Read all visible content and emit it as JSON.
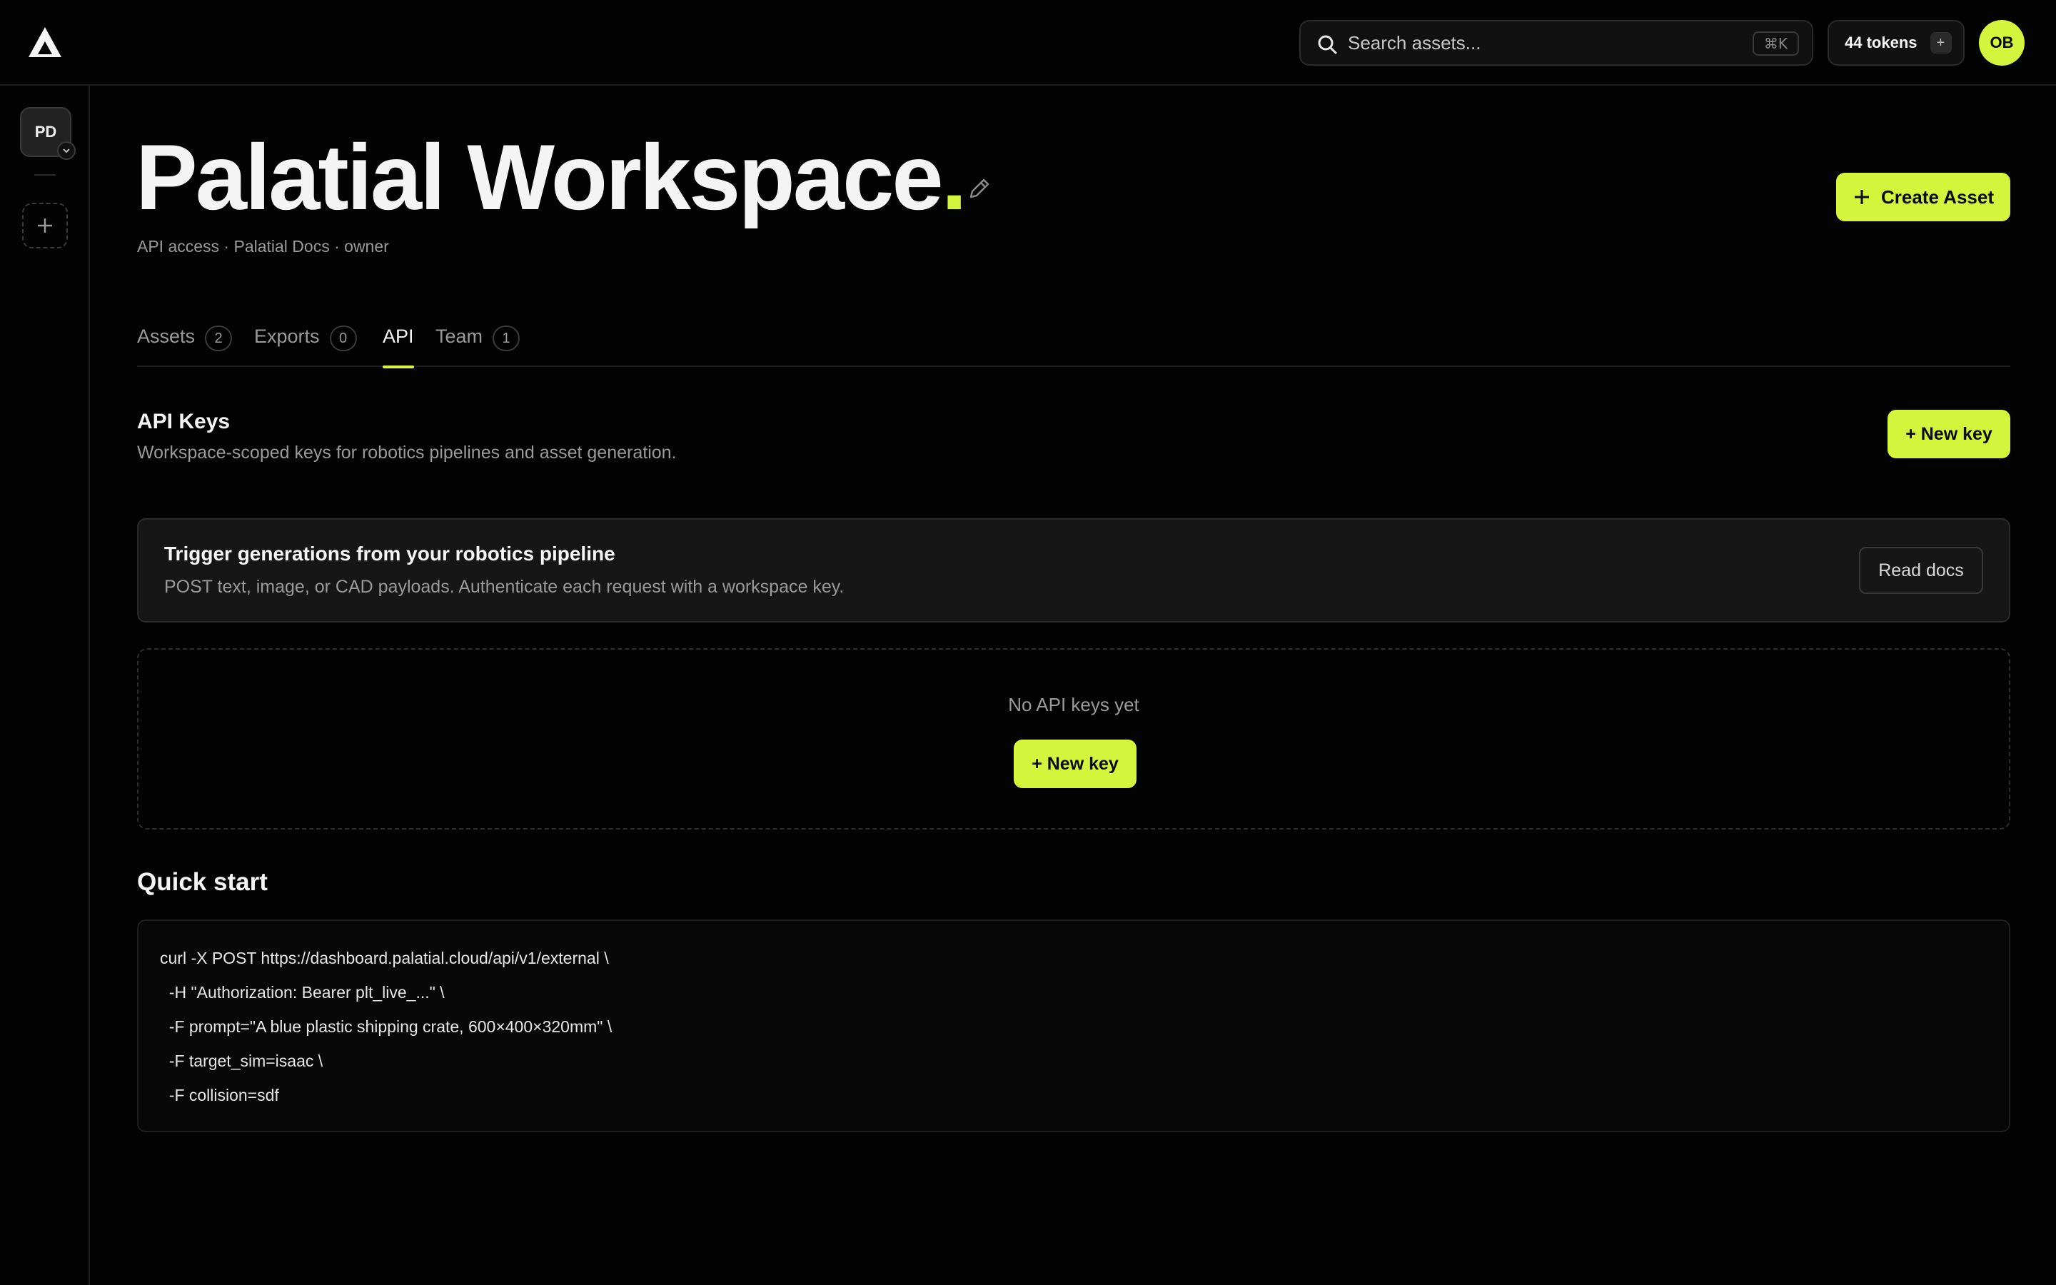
{
  "brand": {
    "accent": "#d4f53c"
  },
  "header": {
    "search_placeholder": "Search assets...",
    "search_shortcut": "⌘K",
    "tokens_label": "44 tokens",
    "tokens_add": "+",
    "user_initials": "OB"
  },
  "sidebar": {
    "workspace_initials": "PD"
  },
  "page": {
    "title": "Palatial Workspace",
    "title_dot": ".",
    "subtitle": "API access · Palatial Docs · owner",
    "create_asset_label": "Create Asset"
  },
  "tabs": [
    {
      "label": "Assets",
      "count": "2"
    },
    {
      "label": "Exports",
      "count": "0"
    },
    {
      "label": "API",
      "count": ""
    },
    {
      "label": "Team",
      "count": "1"
    }
  ],
  "api_keys": {
    "title": "API Keys",
    "description": "Workspace-scoped keys for robotics pipelines and asset generation.",
    "new_key_label": "+ New key"
  },
  "pipeline_card": {
    "title": "Trigger generations from your robotics pipeline",
    "description": "POST text, image, or CAD payloads. Authenticate each request with a workspace key.",
    "read_docs_label": "Read docs"
  },
  "empty_state": {
    "text": "No API keys yet",
    "new_key_label": "+ New key"
  },
  "quick_start": {
    "title": "Quick start",
    "code_lines": [
      "curl -X POST https://dashboard.palatial.cloud/api/v1/external \\",
      "  -H \"Authorization: Bearer plt_live_...\" \\",
      "  -F prompt=\"A blue plastic shipping crate, 600×400×320mm\" \\",
      "  -F target_sim=isaac \\",
      "  -F collision=sdf"
    ]
  }
}
